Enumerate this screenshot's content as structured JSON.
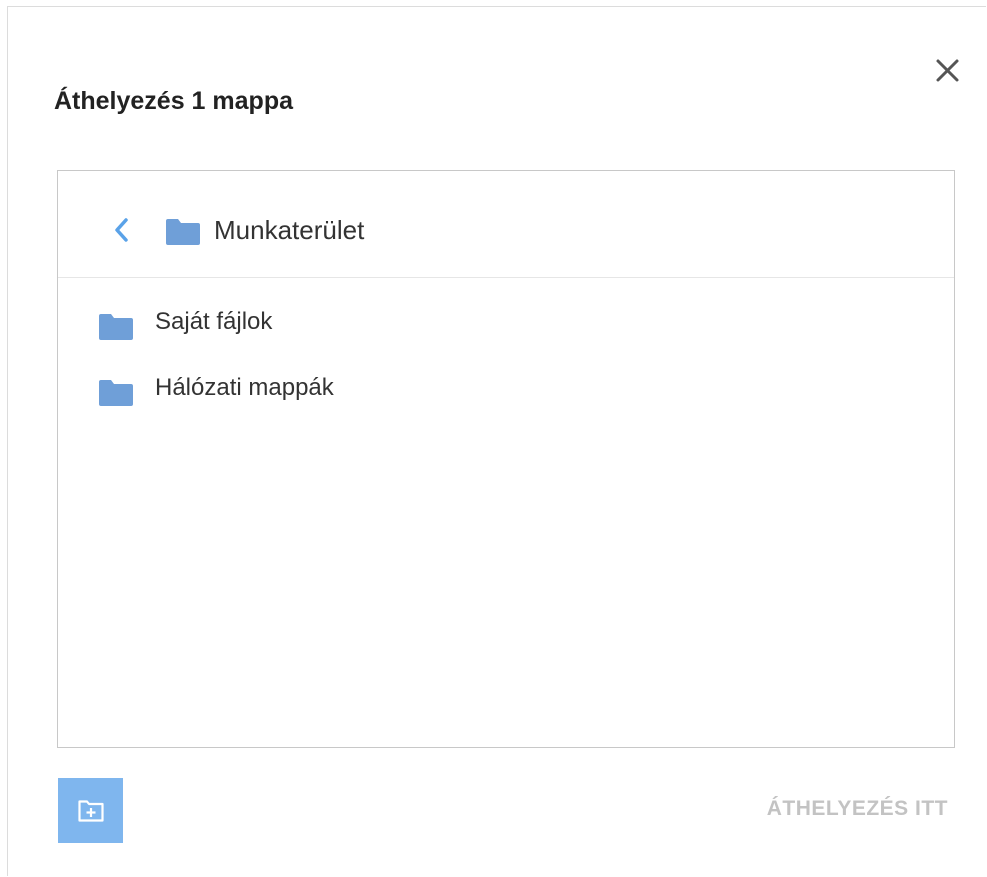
{
  "dialog": {
    "title": "Áthelyezés 1 mappa",
    "close_icon": "close-icon"
  },
  "browser": {
    "current_folder": "Munkaterület",
    "back_icon": "chevron-left-icon",
    "items": [
      {
        "label": "Saját fájlok",
        "icon": "folder-icon"
      },
      {
        "label": "Hálózati mappák",
        "icon": "folder-icon"
      }
    ]
  },
  "footer": {
    "new_folder_icon": "new-folder-icon",
    "move_here_label": "ÁTHELYEZÉS ITT",
    "move_here_enabled": false
  },
  "colors": {
    "accent": "#7fb6ee",
    "folder": "#6f9fd8",
    "back_arrow": "#5aa2e8",
    "disabled_text": "#c3c3c3"
  }
}
